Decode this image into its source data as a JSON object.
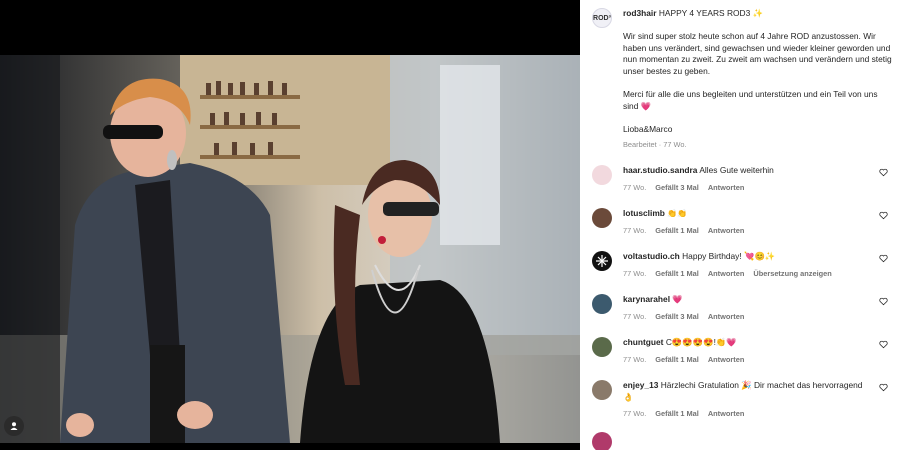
{
  "post": {
    "username": "rod3hair",
    "headline": "HAPPY 4 YEARS ROD3 ✨",
    "avatar_text": "ROD³",
    "paragraphs": [
      "Wir sind super stolz heute schon auf 4 Jahre ROD anzustossen. Wir haben uns verändert, sind gewachsen und wieder kleiner geworden und nun momentan zu zweit. Zu zweit am wachsen und verändern und stetig unser bestes zu geben.",
      "Merci für alle die uns begleiten und unterstützen und ein Teil von uns sind 💗",
      "Lioba&Marco"
    ],
    "meta": "Bearbeitet · 77 Wo."
  },
  "comments": [
    {
      "username": "haar.studio.sandra",
      "text": "Alles Gute weiterhin",
      "time": "77 Wo.",
      "likes": "Gefällt 3 Mal",
      "reply": "Antworten",
      "translate": "",
      "avatar_color": "#f2d9de"
    },
    {
      "username": "lotusclimb",
      "text": "👏👏",
      "time": "77 Wo.",
      "likes": "Gefällt 1 Mal",
      "reply": "Antworten",
      "translate": "",
      "avatar_color": "#6b4a3a"
    },
    {
      "username": "voltastudio.ch",
      "text": "Happy Birthday! 💘😊✨",
      "time": "77 Wo.",
      "likes": "Gefällt 1 Mal",
      "reply": "Antworten",
      "translate": "Übersetzung anzeigen",
      "avatar_color": "#111111"
    },
    {
      "username": "karynarahel",
      "text": "💗",
      "time": "77 Wo.",
      "likes": "Gefällt 3 Mal",
      "reply": "Antworten",
      "translate": "",
      "avatar_color": "#3c5a6e"
    },
    {
      "username": "chuntguet",
      "text": "C😍😍😍😍!👏💗",
      "time": "77 Wo.",
      "likes": "Gefällt 1 Mal",
      "reply": "Antworten",
      "translate": "",
      "avatar_color": "#5a6a4a"
    },
    {
      "username": "enjey_13",
      "text": "Härzlechi Gratulation 🎉 Dir machet das hervorragend 👌",
      "time": "77 Wo.",
      "likes": "Gefällt 1 Mal",
      "reply": "Antworten",
      "translate": "",
      "avatar_color": "#8a7a6a"
    }
  ],
  "colors": {
    "text": "#262626",
    "secondary": "#8e8e8e",
    "media_bg": "#000000"
  },
  "icons": {
    "tag": "user-tag-icon",
    "like": "heart-outline-icon"
  }
}
